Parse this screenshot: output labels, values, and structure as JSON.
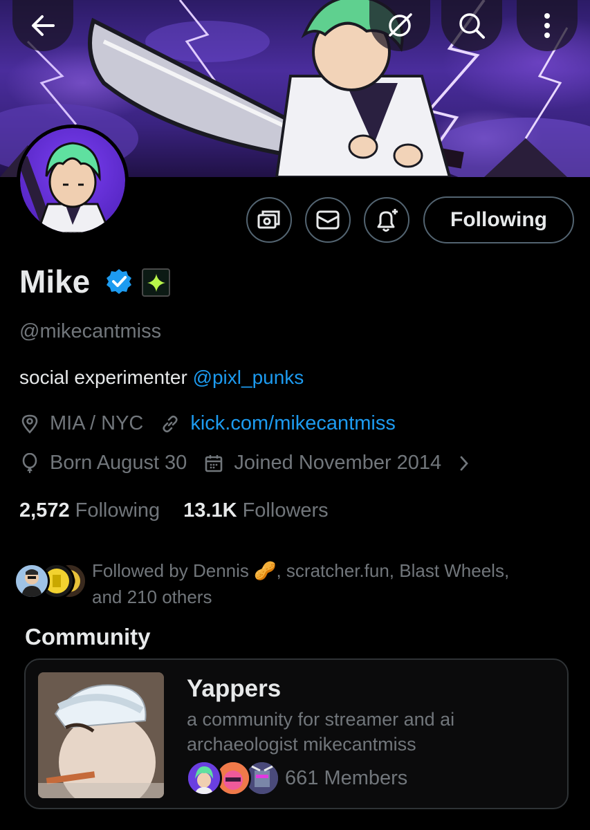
{
  "header": {
    "back_icon": "arrow-left-icon",
    "grok_icon": "grok-icon",
    "search_icon": "search-icon",
    "more_icon": "more-vertical-icon"
  },
  "profile": {
    "name": "Mike",
    "handle": "@mikecantmiss",
    "bio_text": "social experimenter ",
    "bio_mention": "@pixl_punks",
    "location": "MIA / NYC",
    "website": "kick.com/mikecantmiss",
    "birthday": "Born August 30",
    "joined": "Joined November 2014",
    "following_count": "2,572",
    "following_label": "Following",
    "followers_count": "13.1K",
    "followers_label": "Followers"
  },
  "actions": {
    "subscribe_icon": "money-icon",
    "message_icon": "envelope-icon",
    "notify_icon": "bell-plus-icon",
    "follow_label": "Following"
  },
  "followed_by": {
    "line": "Followed by Dennis 🥜, scratcher.fun, Blast Wheels,",
    "line2": "and 210 others"
  },
  "community": {
    "section_title": "Community",
    "name": "Yappers",
    "description": "a community for streamer and ai archaeologist mikecantmiss",
    "members": "661 Members"
  },
  "colors": {
    "accent": "#1d9bf0",
    "muted": "#71767b",
    "text": "#e7e9ea",
    "border": "#536471"
  }
}
